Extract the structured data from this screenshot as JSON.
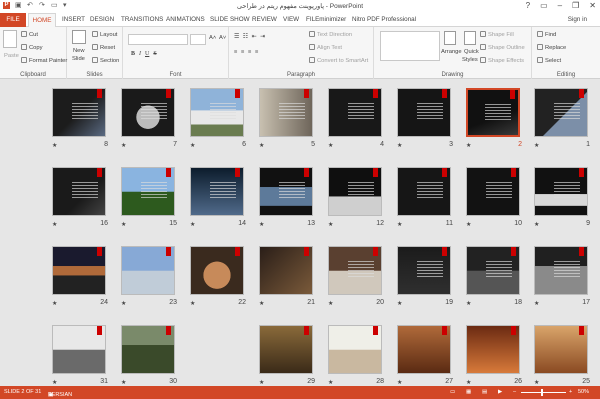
{
  "title": "پاورپوینت مفهوم ریتم در طراحی - PowerPoint",
  "window": {
    "help": "?",
    "minimize": "–",
    "restore": "❐",
    "close": "✕"
  },
  "tabs": {
    "file": "FILE",
    "home": "HOME",
    "insert": "INSERT",
    "design": "DESIGN",
    "transitions": "TRANSITIONS",
    "animations": "ANIMATIONS",
    "slideshow": "SLIDE SHOW",
    "review": "REVIEW",
    "view": "VIEW",
    "fileminimizer": "FILEminimizer",
    "nitro": "Nitro PDF Professional"
  },
  "signin": "Sign in",
  "clipboard": {
    "paste": "Paste",
    "cut": "Cut",
    "copy": "Copy",
    "format_painter": "Format Painter",
    "label": "Clipboard"
  },
  "slides": {
    "new_slide": "New",
    "new_slide2": "Slide",
    "layout": "Layout",
    "reset": "Reset",
    "section": "Section",
    "label": "Slides"
  },
  "font": {
    "bold": "B",
    "italic": "I",
    "underline": "U",
    "strike": "S",
    "label": "Font"
  },
  "paragraph": {
    "text_direction": "Text Direction",
    "align_text": "Align Text",
    "convert_smartart": "Convert to SmartArt",
    "label": "Paragraph"
  },
  "drawing": {
    "arrange": "Arrange",
    "quick_styles": "Quick",
    "quick_styles2": "Styles",
    "shape_fill": "Shape Fill",
    "shape_outline": "Shape Outline",
    "shape_effects": "Shape Effects",
    "label": "Drawing"
  },
  "editing": {
    "find": "Find",
    "replace": "Replace",
    "select": "Select",
    "label": "Editing"
  },
  "slide_numbers": [
    "1",
    "2",
    "3",
    "4",
    "5",
    "6",
    "7",
    "8",
    "9",
    "10",
    "11",
    "12",
    "13",
    "14",
    "15",
    "16",
    "17",
    "18",
    "19",
    "20",
    "21",
    "22",
    "23",
    "24",
    "25",
    "26",
    "27",
    "28",
    "29",
    "30",
    "31"
  ],
  "star": "★",
  "selected_slide": "2",
  "status": {
    "slide": "SLIDE 2 OF 31",
    "lang": "PERSIAN",
    "zoom": "50%"
  },
  "colors": {
    "accent": "#d24726"
  }
}
